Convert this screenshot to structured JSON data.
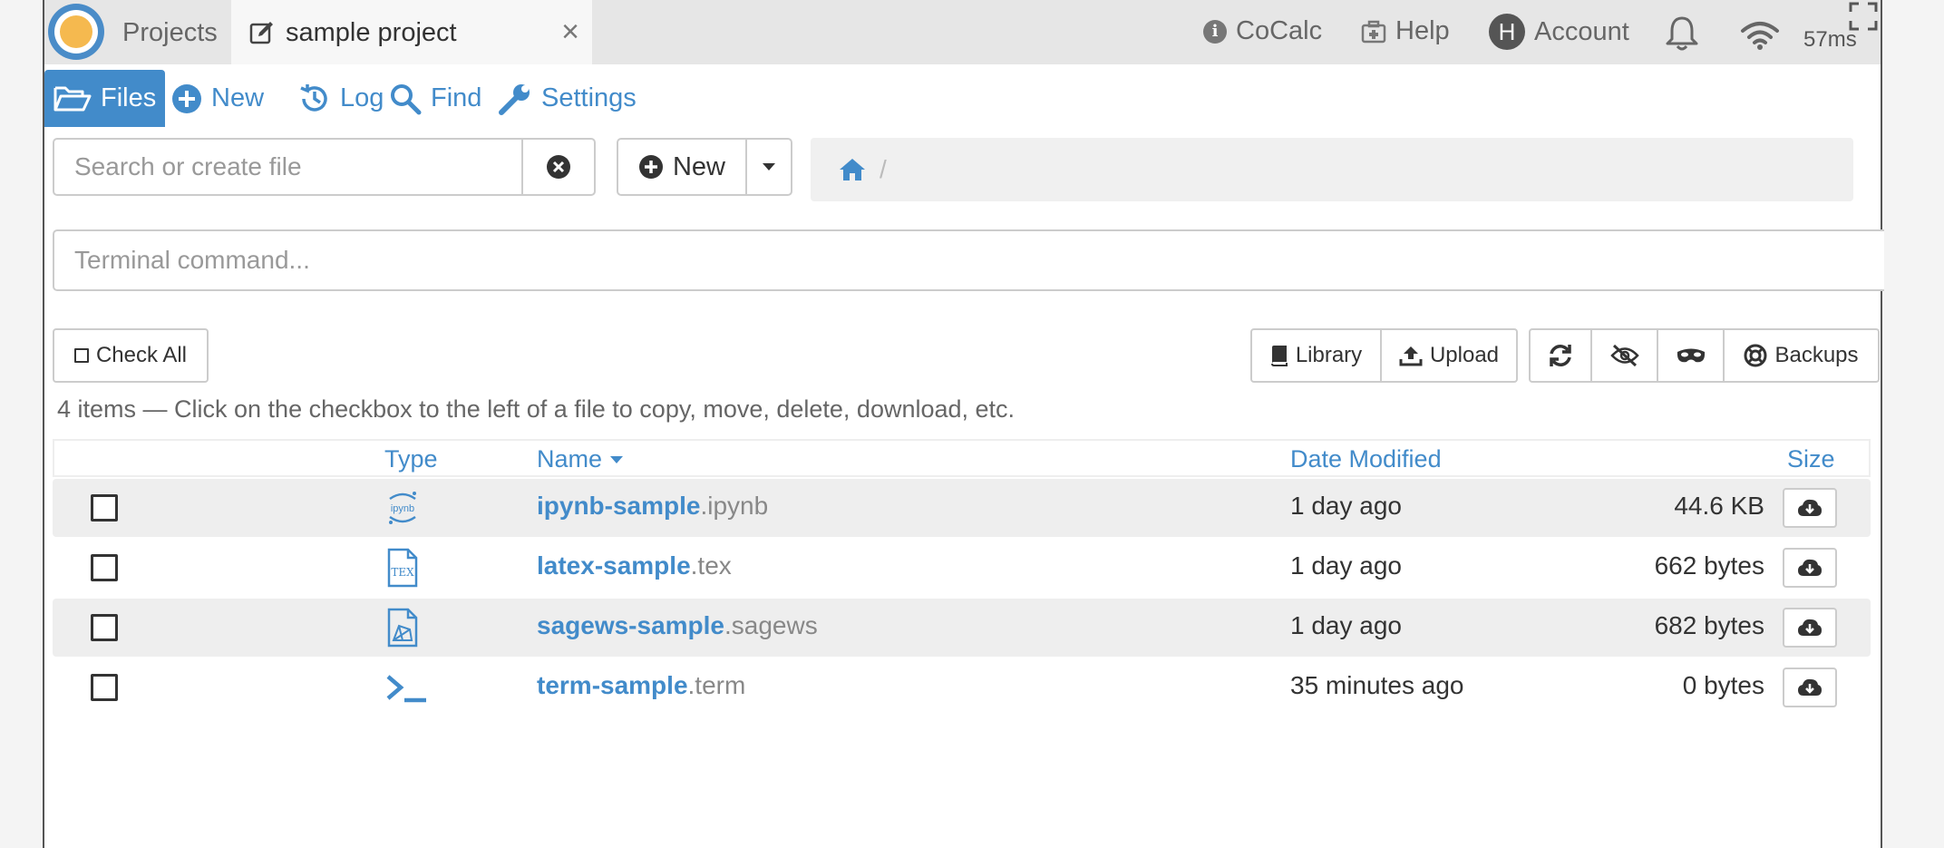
{
  "topbar": {
    "projects_label": "Projects",
    "active_tab_title": "sample project",
    "close_glyph": "×",
    "cocalc_label": "CoCalc",
    "help_label": "Help",
    "account_label": "Account",
    "account_initial": "H",
    "ping": "57ms"
  },
  "nav": [
    {
      "label": "Files",
      "icon": "folder-open-icon"
    },
    {
      "label": "New",
      "icon": "plus-circle-icon"
    },
    {
      "label": "Log",
      "icon": "history-icon"
    },
    {
      "label": "Find",
      "icon": "search-icon"
    },
    {
      "label": "Settings",
      "icon": "wrench-icon"
    }
  ],
  "search": {
    "placeholder": "Search or create file"
  },
  "new_button": {
    "label": "New"
  },
  "breadcrumb": {
    "separator": "/"
  },
  "terminal": {
    "placeholder": "Terminal command..."
  },
  "toolbar": {
    "check_all": "Check All",
    "library": "Library",
    "upload": "Upload",
    "backups": "Backups"
  },
  "items_info": "4 items — Click on the checkbox to the left of a file to copy, move, delete, download, etc.",
  "table": {
    "headers": {
      "type": "Type",
      "name": "Name",
      "date": "Date Modified",
      "size": "Size"
    },
    "rows": [
      {
        "base": "ipynb-sample",
        "ext": ".ipynb",
        "date": "1 day ago",
        "size": "44.6 KB",
        "icon": "jupyter-icon"
      },
      {
        "base": "latex-sample",
        "ext": ".tex",
        "date": "1 day ago",
        "size": "662 bytes",
        "icon": "tex-file-icon"
      },
      {
        "base": "sagews-sample",
        "ext": ".sagews",
        "date": "1 day ago",
        "size": "682 bytes",
        "icon": "sage-file-icon"
      },
      {
        "base": "term-sample",
        "ext": ".term",
        "date": "35 minutes ago",
        "size": "0 bytes",
        "icon": "terminal-icon"
      }
    ]
  },
  "colors": {
    "accent": "#428bca",
    "topbar": "#e6e6e6",
    "row_shade": "#eeeeee"
  }
}
